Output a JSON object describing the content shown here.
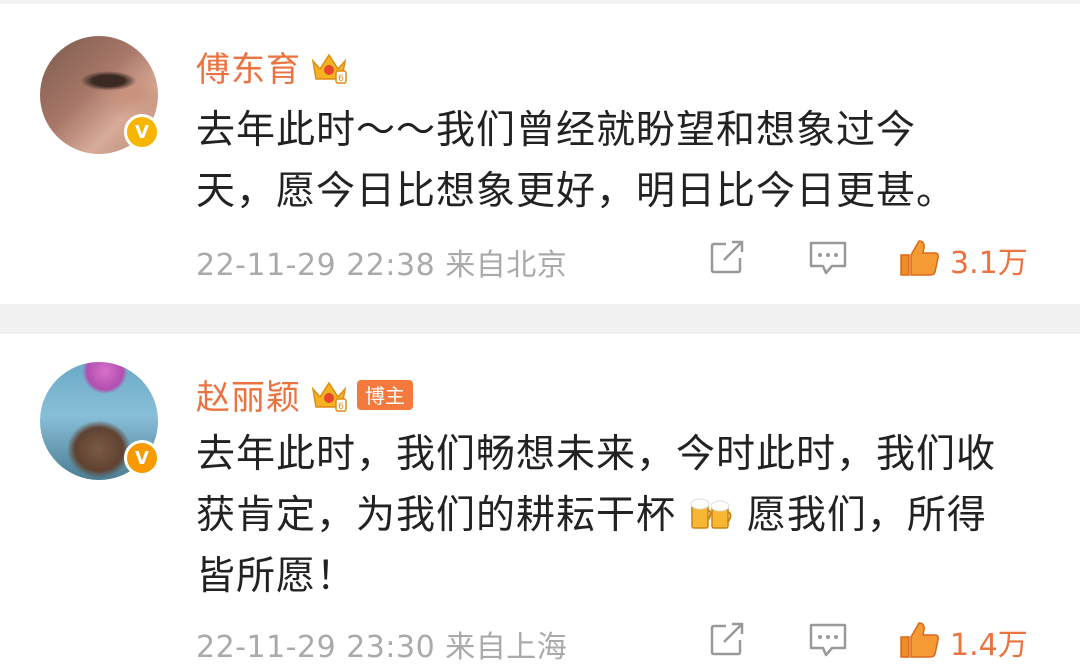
{
  "colors": {
    "username": "#eb7340",
    "text": "#222222",
    "meta": "#aaaaaa",
    "liked": "#eb7340",
    "badge_tag": "#f4793c",
    "verified_gold": "#f7b500"
  },
  "comments": [
    {
      "username": "傅东育",
      "crown_icon": "crown-vip-icon",
      "verified_icon": "verified-v-icon",
      "verified_label": "V",
      "text_lines": [
        "去年此时～～我们曾经就盼望和想象过今",
        "天，愿今日比想象更好，明日比今日更甚。"
      ],
      "timestamp": "22-11-29 22:38",
      "location": "来自北京",
      "likes": "3.1万",
      "liked": true
    },
    {
      "username": "赵丽颖",
      "crown_icon": "crown-vip-icon",
      "tag": "博主",
      "verified_icon": "verified-v-icon",
      "verified_label": "V",
      "text_lines": [
        "去年此时，我们畅想未来，今时此时，我们收",
        "获肯定，为我们的耕耘干杯",
        "愿我们，所得",
        "皆所愿！"
      ],
      "emoji": "beer-emoji-icon",
      "timestamp": "22-11-29 23:30",
      "location": "来自上海",
      "likes": "1.4万",
      "liked": true
    }
  ]
}
